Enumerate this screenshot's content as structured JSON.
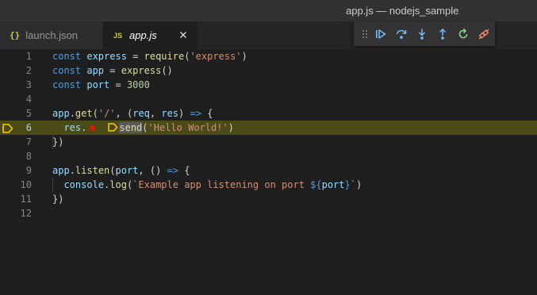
{
  "window": {
    "title": "app.js — nodejs_sample"
  },
  "tabs": [
    {
      "icon": "{}",
      "label": "launch.json"
    },
    {
      "icon": "JS",
      "label": "app.js"
    }
  ],
  "debug_toolbar": {
    "buttons": [
      "continue",
      "step-over",
      "step-into",
      "step-out",
      "restart",
      "disconnect"
    ]
  },
  "editor": {
    "line_numbers": [
      "1",
      "2",
      "3",
      "4",
      "5",
      "6",
      "7",
      "8",
      "9",
      "10",
      "11",
      "12"
    ],
    "current_line": "6",
    "lines": [
      [
        [
          "kw",
          "const"
        ],
        [
          "p",
          " "
        ],
        [
          "var",
          "express"
        ],
        [
          "p",
          " = "
        ],
        [
          "fn",
          "require"
        ],
        [
          "p",
          "("
        ],
        [
          "str",
          "'express'"
        ],
        [
          "p",
          ")"
        ]
      ],
      [
        [
          "kw",
          "const"
        ],
        [
          "p",
          " "
        ],
        [
          "var",
          "app"
        ],
        [
          "p",
          " = "
        ],
        [
          "fn",
          "express"
        ],
        [
          "p",
          "()"
        ]
      ],
      [
        [
          "kw",
          "const"
        ],
        [
          "p",
          " "
        ],
        [
          "var",
          "port"
        ],
        [
          "p",
          " = "
        ],
        [
          "num",
          "3000"
        ]
      ],
      [],
      [
        [
          "var",
          "app"
        ],
        [
          "p",
          "."
        ],
        [
          "fn",
          "get"
        ],
        [
          "p",
          "("
        ],
        [
          "str",
          "'/'"
        ],
        [
          "p",
          ", ("
        ],
        [
          "var",
          "req"
        ],
        [
          "p",
          ", "
        ],
        [
          "var",
          "res"
        ],
        [
          "p",
          ") "
        ],
        [
          "kw",
          "=>"
        ],
        [
          "p",
          " {"
        ]
      ],
      [
        [
          "p",
          "  "
        ],
        [
          "var",
          "res"
        ],
        [
          "p",
          "."
        ],
        [
          "bp",
          ""
        ],
        [
          "stop",
          ""
        ],
        [
          "fn-hl",
          "send"
        ],
        [
          "p",
          "("
        ],
        [
          "str",
          "'Hello World!'"
        ],
        [
          "p",
          ")"
        ]
      ],
      [
        [
          "p",
          "})"
        ]
      ],
      [],
      [
        [
          "var",
          "app"
        ],
        [
          "p",
          "."
        ],
        [
          "fn",
          "listen"
        ],
        [
          "p",
          "("
        ],
        [
          "var",
          "port"
        ],
        [
          "p",
          ", () "
        ],
        [
          "kw",
          "=>"
        ],
        [
          "p",
          " {"
        ]
      ],
      [
        [
          "p",
          "  "
        ],
        [
          "var",
          "console"
        ],
        [
          "p",
          "."
        ],
        [
          "fn",
          "log"
        ],
        [
          "p",
          "("
        ],
        [
          "str",
          "`Example app listening on port "
        ],
        [
          "kw",
          "${"
        ],
        [
          "var",
          "port"
        ],
        [
          "kw",
          "}"
        ],
        [
          "str",
          "`"
        ],
        [
          "p",
          ")"
        ]
      ],
      [
        [
          "p",
          "})"
        ]
      ],
      []
    ]
  }
}
